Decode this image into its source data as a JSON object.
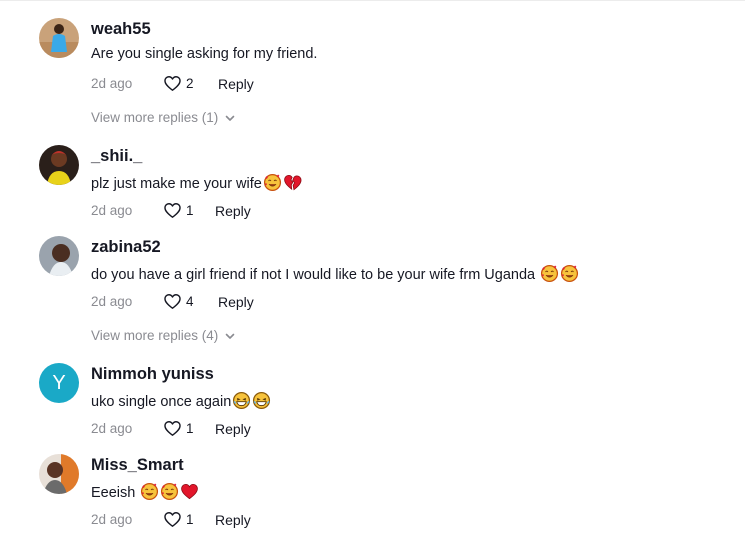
{
  "comments": [
    {
      "username": "weah55",
      "text": "Are you single asking for my friend.",
      "emojis": [],
      "time": "2d ago",
      "likes": "2",
      "reply": "Reply",
      "view_more": "View more replies (1)"
    },
    {
      "username": "_shii._",
      "text": "plz just make me your wife",
      "emojis": [
        "smiling-face-with-hearts-icon",
        "broken-heart-icon"
      ],
      "time": "2d ago",
      "likes": "1",
      "reply": "Reply"
    },
    {
      "username": "zabina52",
      "text": "do you have a girl friend if not I would like to be your wife frm Uganda ",
      "emojis": [
        "smiling-face-with-hearts-icon",
        "smiling-face-with-hearts-icon"
      ],
      "time": "2d ago",
      "likes": "4",
      "reply": "Reply",
      "view_more": "View more replies (4)"
    },
    {
      "username": "Nimmoh yuniss",
      "avatar_letter": "Y",
      "text": "uko single once again",
      "emojis": [
        "laughing-face-icon",
        "laughing-face-icon"
      ],
      "time": "2d ago",
      "likes": "1",
      "reply": "Reply"
    },
    {
      "username": "Miss_Smart",
      "text": "Eeeish ",
      "emojis": [
        "smiling-face-with-hearts-icon",
        "smiling-face-with-hearts-icon",
        "red-heart-icon"
      ],
      "time": "2d ago",
      "likes": "1",
      "reply": "Reply"
    }
  ],
  "colors": {
    "text": "#161823",
    "muted": "#8a8b91",
    "avatar_letter_bg": "#1aa9c7"
  }
}
